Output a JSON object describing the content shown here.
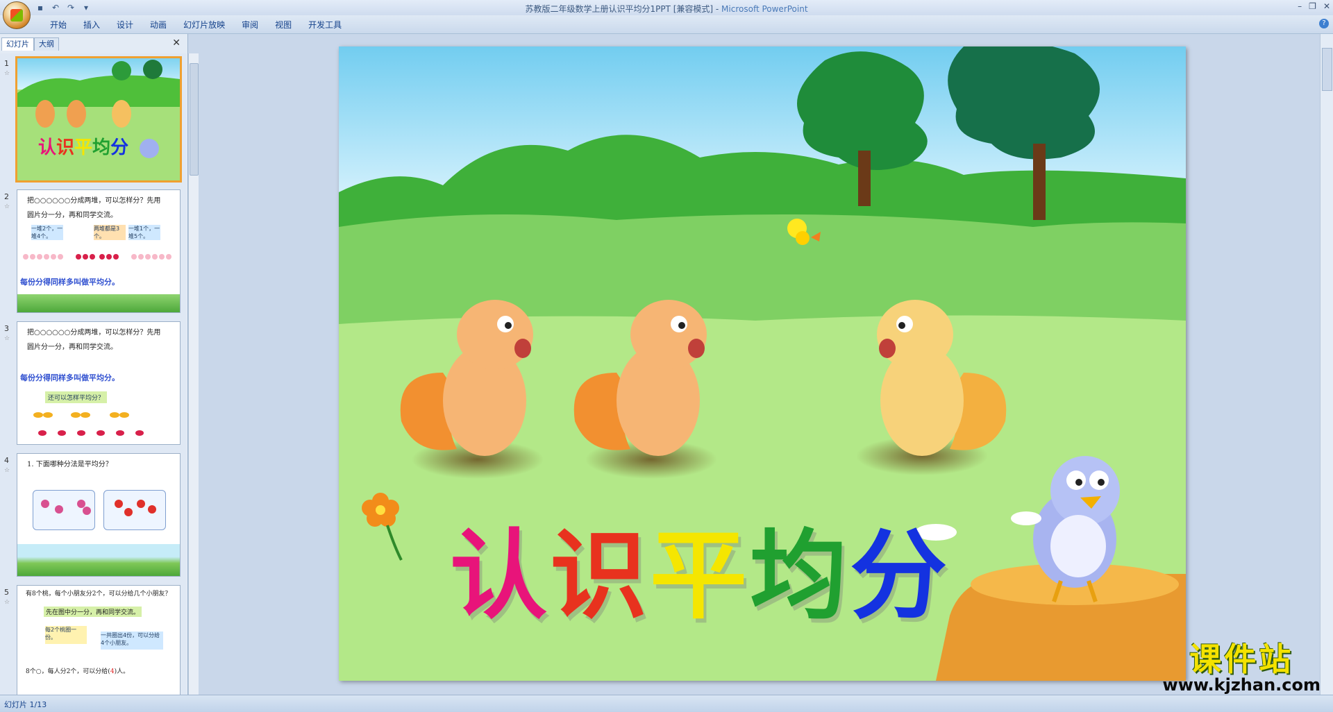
{
  "window": {
    "title": "苏教版二年级数学上册认识平均分1PPT [兼容模式]",
    "separator": " - ",
    "app_name": "Microsoft PowerPoint"
  },
  "ribbon": {
    "tabs": [
      "开始",
      "插入",
      "设计",
      "动画",
      "幻灯片放映",
      "审阅",
      "视图",
      "开发工具"
    ]
  },
  "panel": {
    "tabs": [
      "幻灯片",
      "大纲"
    ],
    "close_label": "✕"
  },
  "thumbnails": [
    {
      "num": "1",
      "title": "认识平均分"
    },
    {
      "num": "2",
      "line1": "把○○○○○○分成两堆，可以怎样分？先用",
      "line2": "圆片分一分，再和同学交流。",
      "box1": "一堆2个，一堆4个。",
      "box2": "两堆都是3个。",
      "box3": "一堆1个，一堆5个。",
      "footer": "每份分得同样多叫做平均分。"
    },
    {
      "num": "3",
      "line1": "把○○○○○○分成两堆，可以怎样分？先用",
      "line2": "圆片分一分，再和同学交流。",
      "footer": "每份分得同样多叫做平均分。",
      "question": "还可以怎样平均分？"
    },
    {
      "num": "4",
      "line1": "1. 下面哪种分法是平均分？"
    },
    {
      "num": "5",
      "line1": "有8个桃，每个小朋友分2个，可以分给几个小朋友？",
      "line2": "先在图中分一分，再和同学交流。",
      "box1": "每2个桃圈一份。",
      "box2": "一共圈出4份，可以分给4个小朋友。",
      "footer": "8个○，每人分2个，可以分给(",
      "answer": "4",
      "footer_end": ")人。"
    }
  ],
  "slide": {
    "title_chars": [
      "认",
      "识",
      "平",
      "均",
      "分"
    ],
    "title_colors": [
      "#e8147a",
      "#e8321e",
      "#f5e600",
      "#20a030",
      "#1432e0"
    ]
  },
  "status": {
    "text": "幻灯片 1/13"
  },
  "watermark": {
    "line1": "课件站",
    "line2": "www.kjzhan.com"
  }
}
